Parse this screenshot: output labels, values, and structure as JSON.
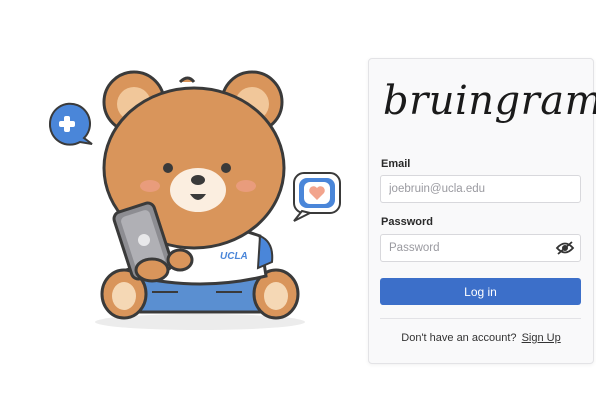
{
  "brand": {
    "logo_text": "bruingram"
  },
  "illustration": {
    "shirt_text": "UCLA",
    "icons": [
      "plus-icon",
      "heart-icon",
      "apple-logo-icon"
    ]
  },
  "login": {
    "email_label": "Email",
    "email_placeholder": "joebruin@ucla.edu",
    "password_label": "Password",
    "password_placeholder": "Password",
    "login_button": "Log in",
    "signup_prompt": "Don't have an account?",
    "signup_link": "Sign Up"
  },
  "colors": {
    "primary": "#3c6fc9",
    "bear_fur": "#d9955b",
    "bubble_blue": "#4a86d9",
    "heart": "#f2a48d"
  }
}
